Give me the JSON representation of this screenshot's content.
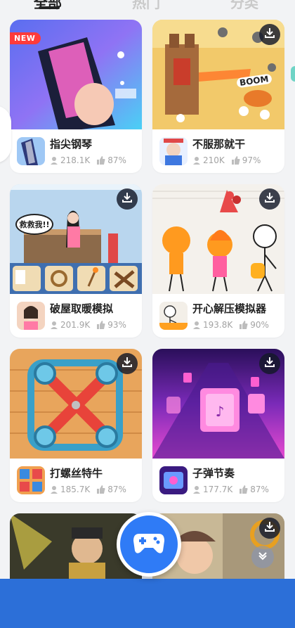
{
  "tabs": [
    {
      "label": "全部",
      "active": true
    },
    {
      "label": "热门",
      "active": false
    },
    {
      "label": "分类",
      "active": false
    }
  ],
  "badge_new": "NEW",
  "games": [
    {
      "name": "指尖钢琴",
      "plays": "218.1K",
      "rating": "87%",
      "icon": "piano-tiles-icon"
    },
    {
      "name": "不服那就干",
      "plays": "210K",
      "rating": "97%",
      "icon": "castle-defense-icon"
    },
    {
      "name": "破屋取暖模拟",
      "plays": "201.9K",
      "rating": "93%",
      "icon": "cold-house-icon"
    },
    {
      "name": "开心解压模拟器",
      "plays": "193.8K",
      "rating": "90%",
      "icon": "stickman-icon"
    },
    {
      "name": "打螺丝特牛",
      "plays": "185.7K",
      "rating": "87%",
      "icon": "screw-puzzle-icon"
    },
    {
      "name": "子弹节奏",
      "plays": "177.7K",
      "rating": "87%",
      "icon": "music-tiles-icon"
    }
  ],
  "art_text": {
    "help_bubble": "救救我!!",
    "boom": "BOOM"
  },
  "colors": {
    "bottom_bar": "#2c6fd8",
    "fab": "#2f7bf6",
    "card_bg": "#ffffff",
    "page_bg": "#f2f3f5"
  },
  "icons": {
    "download": "download-icon",
    "user": "user-icon",
    "thumbs_up": "thumbs-up-icon",
    "gamepad": "gamepad-icon",
    "scroll": "chevron-down-icon"
  }
}
